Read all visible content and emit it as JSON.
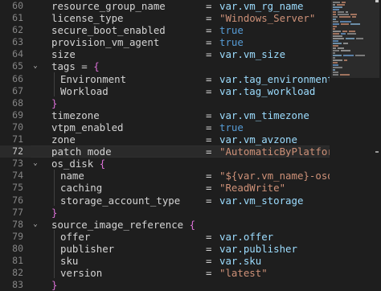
{
  "editor": {
    "active_line": "72",
    "lines": [
      {
        "n": "60",
        "fold": "",
        "indent": false,
        "key": "resource_group_name",
        "value": "var.vm_rg_name",
        "value_type": "var",
        "brace": ""
      },
      {
        "n": "61",
        "fold": "",
        "indent": false,
        "key": "license_type",
        "value": "\"Windows_Server\"",
        "value_type": "str",
        "brace": ""
      },
      {
        "n": "62",
        "fold": "",
        "indent": false,
        "key": "secure_boot_enabled",
        "value": "true",
        "value_type": "kw",
        "brace": ""
      },
      {
        "n": "63",
        "fold": "",
        "indent": false,
        "key": "provision_vm_agent",
        "value": "true",
        "value_type": "kw",
        "brace": ""
      },
      {
        "n": "64",
        "fold": "",
        "indent": false,
        "key": "size",
        "value": "var.vm_size",
        "value_type": "var",
        "brace": ""
      },
      {
        "n": "65",
        "fold": "⌄",
        "indent": false,
        "key": "tags = ",
        "value": "",
        "value_type": "",
        "brace": "{"
      },
      {
        "n": "66",
        "fold": "",
        "indent": true,
        "key": "Environment",
        "value": "var.tag_environment",
        "value_type": "var",
        "brace": ""
      },
      {
        "n": "67",
        "fold": "",
        "indent": true,
        "key": "Workload",
        "value": "var.tag_workload",
        "value_type": "var",
        "brace": ""
      },
      {
        "n": "68",
        "fold": "",
        "indent": false,
        "key": "",
        "value": "",
        "value_type": "",
        "brace": "}"
      },
      {
        "n": "69",
        "fold": "",
        "indent": false,
        "key": "timezone",
        "value": "var.vm_timezone",
        "value_type": "var",
        "brace": ""
      },
      {
        "n": "70",
        "fold": "",
        "indent": false,
        "key": "vtpm_enabled",
        "value": "true",
        "value_type": "kw",
        "brace": ""
      },
      {
        "n": "71",
        "fold": "",
        "indent": false,
        "key": "zone",
        "value": "var.vm_avzone",
        "value_type": "var",
        "brace": ""
      },
      {
        "n": "72",
        "fold": "",
        "indent": false,
        "key": "patch_mode",
        "value": "\"AutomaticByPlatform\"",
        "value_type": "str",
        "brace": ""
      },
      {
        "n": "73",
        "fold": "⌄",
        "indent": false,
        "key": "os_disk ",
        "value": "",
        "value_type": "",
        "brace": "{"
      },
      {
        "n": "74",
        "fold": "",
        "indent": true,
        "key": "name",
        "value": "\"${var.vm_name}-osdisk",
        "value_type": "str",
        "brace": ""
      },
      {
        "n": "75",
        "fold": "",
        "indent": true,
        "key": "caching",
        "value": "\"ReadWrite\"",
        "value_type": "str",
        "brace": ""
      },
      {
        "n": "76",
        "fold": "",
        "indent": true,
        "key": "storage_account_type",
        "value": "var.vm_storage",
        "value_type": "var",
        "brace": ""
      },
      {
        "n": "77",
        "fold": "",
        "indent": false,
        "key": "",
        "value": "",
        "value_type": "",
        "brace": "}"
      },
      {
        "n": "78",
        "fold": "⌄",
        "indent": false,
        "key": "source_image_reference ",
        "value": "",
        "value_type": "",
        "brace": "{"
      },
      {
        "n": "79",
        "fold": "",
        "indent": true,
        "key": "offer",
        "value": "var.offer",
        "value_type": "var",
        "brace": ""
      },
      {
        "n": "80",
        "fold": "",
        "indent": true,
        "key": "publisher",
        "value": "var.publisher",
        "value_type": "var",
        "brace": ""
      },
      {
        "n": "81",
        "fold": "",
        "indent": true,
        "key": "sku",
        "value": "var.sku",
        "value_type": "var",
        "brace": ""
      },
      {
        "n": "82",
        "fold": "",
        "indent": true,
        "key": "version",
        "value": "\"latest\"",
        "value_type": "str",
        "brace": ""
      },
      {
        "n": "83",
        "fold": "",
        "indent": false,
        "key": "",
        "value": "",
        "value_type": "",
        "brace": "}"
      }
    ],
    "equals_sign": "="
  },
  "theme": {
    "background": "#1e1e1e",
    "string_color": "#ce9178",
    "keyword_color": "#569cd6",
    "variable_color": "#9cdcfe",
    "brace_color": "#da70d6",
    "text_color": "#d4d4d4"
  }
}
